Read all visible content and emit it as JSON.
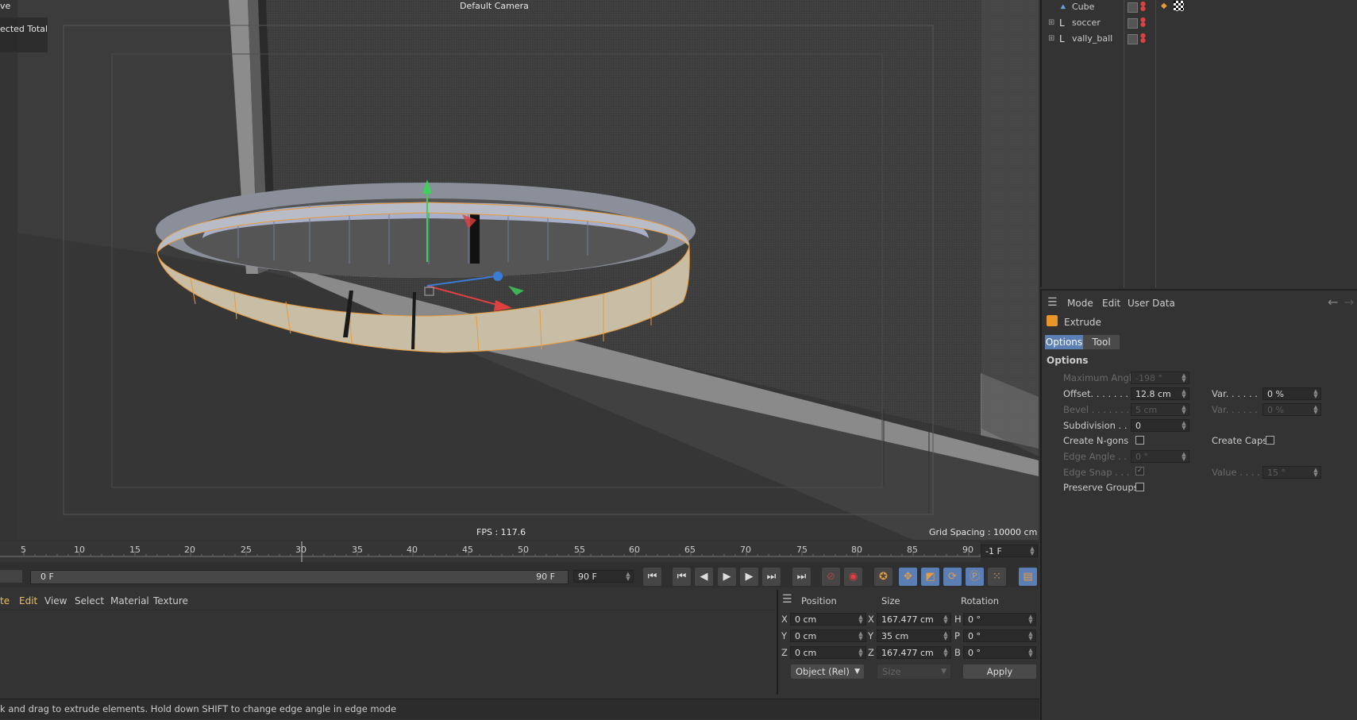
{
  "viewport": {
    "camera_label": "Default Camera",
    "top_left_text_1": "ve",
    "top_left_text_2": "ected Total",
    "fps": "FPS : 117.6",
    "grid_spacing": "Grid Spacing : 10000 cm"
  },
  "object_manager": {
    "objects": [
      {
        "name": "Cube",
        "icon": "cube-object-icon"
      },
      {
        "name": "soccer",
        "icon": "null-object-icon"
      },
      {
        "name": "vally_ball",
        "icon": "null-object-icon"
      }
    ]
  },
  "attribute_manager": {
    "menu": {
      "mode": "Mode",
      "edit": "Edit",
      "user_data": "User Data"
    },
    "tool_name": "Extrude",
    "tabs": {
      "options": "Options",
      "tool": "Tool"
    },
    "section_title": "Options",
    "fields": {
      "max_angle_label": "Maximum Angle",
      "max_angle_value": "-198 °",
      "offset_label": "Offset. . . . . . .",
      "offset_value": "12.8 cm",
      "offset_var_label": "Var. . . . . .",
      "offset_var_value": "0 %",
      "bevel_label": "Bevel . . . . . . .",
      "bevel_value": "5 cm",
      "bevel_var_label": "Var. . . . . .",
      "bevel_var_value": "0 %",
      "subdivision_label": "Subdivision . . .",
      "subdivision_value": "0",
      "create_ngons_label": "Create N-gons",
      "create_caps_label": "Create Caps",
      "edge_angle_label": "Edge Angle . . .",
      "edge_angle_value": "0 °",
      "edge_snap_label": "Edge Snap . . .",
      "value_label": "Value . . . .",
      "value_value": "15 °",
      "preserve_groups_label": "Preserve Groups"
    }
  },
  "timeline": {
    "ticks": [
      "5",
      "10",
      "15",
      "20",
      "25",
      "30",
      "35",
      "40",
      "45",
      "50",
      "55",
      "60",
      "65",
      "70",
      "75",
      "80",
      "85",
      "90"
    ],
    "current_frame": "-1 F",
    "range_start": "0 F",
    "range_end": "90 F",
    "end_field": "90 F"
  },
  "material_manager": {
    "menu": [
      "te",
      "Edit",
      "View",
      "Select",
      "Material",
      "Texture"
    ]
  },
  "coordinates": {
    "headers": {
      "position": "Position",
      "size": "Size",
      "rotation": "Rotation"
    },
    "rows": [
      {
        "axis": "X",
        "pos": "0 cm",
        "size_axis": "X",
        "size": "167.477 cm",
        "rot_axis": "H",
        "rot": "0 °"
      },
      {
        "axis": "Y",
        "pos": "0 cm",
        "size_axis": "Y",
        "size": "35 cm",
        "rot_axis": "P",
        "rot": "0 °"
      },
      {
        "axis": "Z",
        "pos": "0 cm",
        "size_axis": "Z",
        "size": "167.477 cm",
        "rot_axis": "B",
        "rot": "0 °"
      }
    ],
    "mode_select": "Object (Rel)",
    "size_select": "Size",
    "apply": "Apply"
  },
  "status": {
    "text": "k and drag to extrude elements. Hold down SHIFT to change edge angle in edge mode"
  },
  "colors": {
    "accent_blue": "#5b9bd5",
    "selection_orange": "#e89a3c",
    "axis_green": "#3ecf5a",
    "axis_red": "#e04040",
    "axis_blue": "#3a7bd5"
  }
}
